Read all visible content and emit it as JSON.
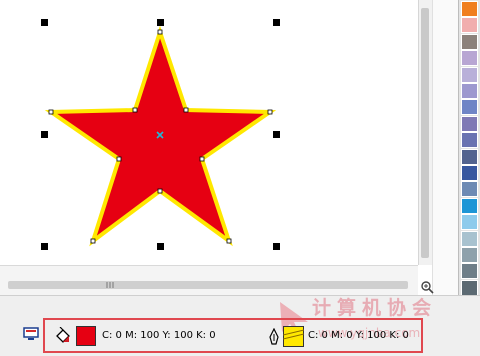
{
  "status": {
    "fill_text": "C: 0 M: 100 Y: 100 K: 0",
    "outline_text": "C: 0 M: 0 Y: 100 K: 0",
    "fill_color": "#e60012",
    "outline_color": "#ffe800"
  },
  "star": {
    "fill": "#e60012",
    "stroke": "#ffe800"
  },
  "palette": {
    "colors": [
      "#f07f1f",
      "#f1aeae",
      "#8c817b",
      "#b8a6d3",
      "#b9b0d9",
      "#9d98cf",
      "#6f85c6",
      "#7f79b5",
      "#6a73b1",
      "#52638f",
      "#37579f",
      "#6d8ab4",
      "#1e96d6",
      "#8ecbec",
      "#a8c2cf",
      "#8ea1ab",
      "#6e7e88",
      "#5c6a73"
    ]
  },
  "watermark": {
    "cn": "计算机协会",
    "url": "www.yqjnba.com"
  }
}
